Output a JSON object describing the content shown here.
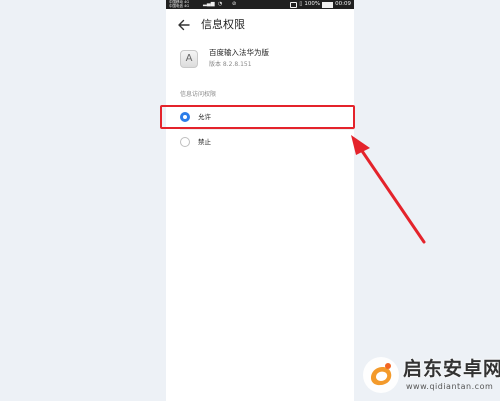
{
  "status_bar": {
    "carrier_line1": "中国移动 4G",
    "carrier_line2": "中国电信 4G",
    "battery": "100%",
    "time": "00:09"
  },
  "header": {
    "title": "信息权限",
    "back_icon": "arrow-left-icon"
  },
  "app": {
    "icon_letter": "A",
    "name": "百度输入法华为版",
    "version": "版本 8.2.8.151"
  },
  "section": {
    "label": "信息访问权限"
  },
  "options": [
    {
      "label": "允许",
      "selected": true
    },
    {
      "label": "禁止",
      "selected": false
    }
  ],
  "annotation": {
    "highlight_color": "#e4232b",
    "arrow_color": "#e4232b"
  },
  "watermark": {
    "title": "启东安卓网",
    "url": "www.qidiantan.com"
  },
  "colors": {
    "accent": "#2b7de9",
    "status_bar": "#202020"
  }
}
